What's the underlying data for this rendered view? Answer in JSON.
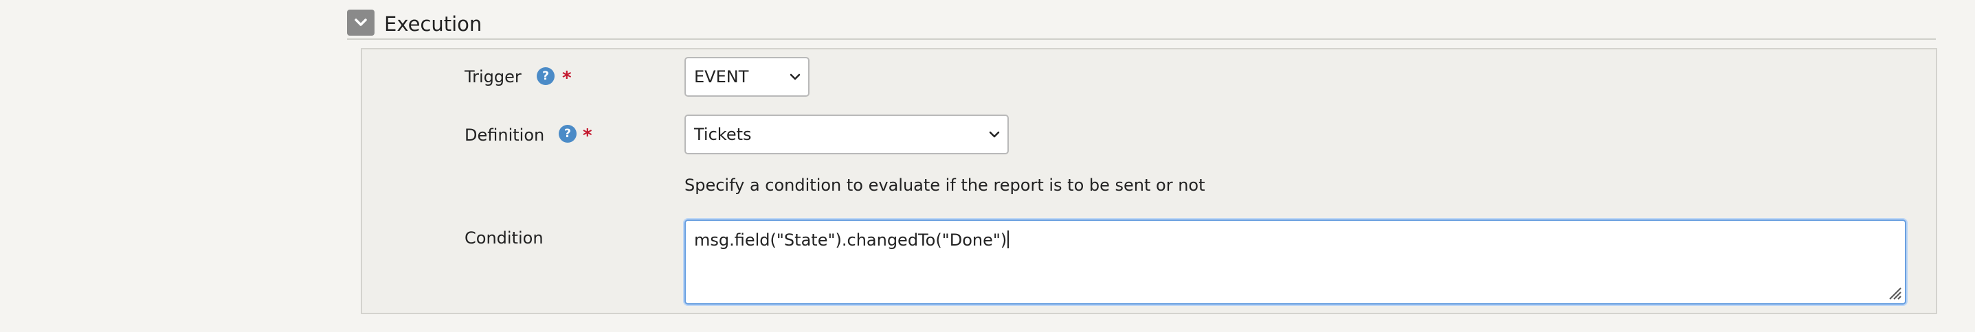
{
  "section": {
    "title": "Execution",
    "collapse_icon": "chevron-down-icon"
  },
  "fields": {
    "trigger": {
      "label": "Trigger",
      "help_icon": "question-mark-icon",
      "help_glyph": "?",
      "required_mark": "*",
      "value": "EVENT"
    },
    "definition": {
      "label": "Definition",
      "help_icon": "question-mark-icon",
      "help_glyph": "?",
      "required_mark": "*",
      "value": "Tickets"
    },
    "condition": {
      "hint": "Specify a condition to evaluate if the report is to be sent or not",
      "label": "Condition",
      "value": "msg.field(\"State\").changedTo(\"Done\")"
    }
  },
  "colors": {
    "help_icon_bg": "#4b8bc7",
    "required": "#c3172d",
    "focus_border": "#6aa0e0",
    "collapse_button_bg": "#8a8a8a"
  }
}
